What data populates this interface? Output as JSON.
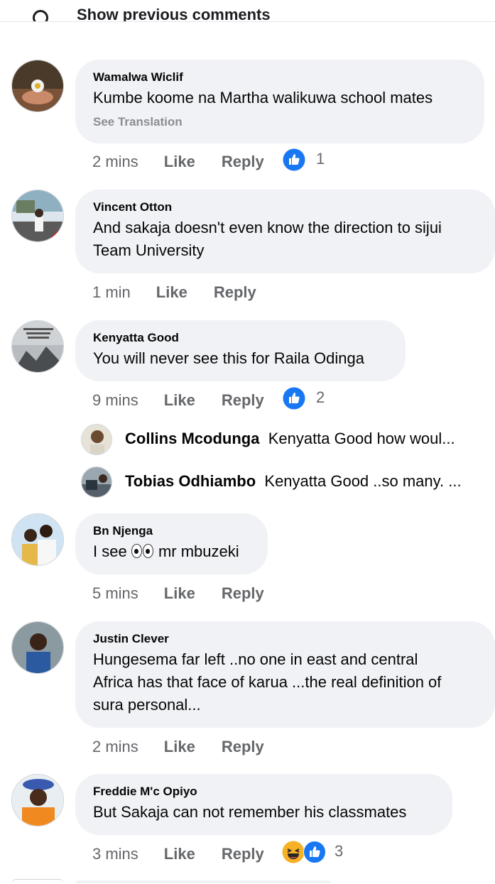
{
  "top": {
    "prev_label": "Show previous comments"
  },
  "comments": [
    {
      "author": "Wamalwa Wiclif",
      "text": "Kumbe koome na Martha walikuwa school mates",
      "see_translation": "See Translation",
      "time": "2 mins",
      "like": "Like",
      "reply": "Reply",
      "reaction_count": "1"
    },
    {
      "author": "Vincent Otton",
      "text_line1": "And sakaja doesn't even know the direction to sijui",
      "text_line2": "Team University",
      "time": "1 min",
      "like": "Like",
      "reply": "Reply"
    },
    {
      "author": "Kenyatta Good",
      "text": "You will never see this for Raila Odinga",
      "time": "9 mins",
      "like": "Like",
      "reply": "Reply",
      "reaction_count": "2",
      "replies": [
        {
          "author": "Collins Mcodunga",
          "text": "Kenyatta Good how woul..."
        },
        {
          "author": "Tobias Odhiambo",
          "text": "Kenyatta Good ..so many. ..."
        }
      ]
    },
    {
      "author": "Bn Njenga",
      "text_pre": "I see",
      "text_post": "mr mbuzeki",
      "time": "5 mins",
      "like": "Like",
      "reply": "Reply"
    },
    {
      "author": "Justin Clever",
      "text_line1": "Hungesema far left ..no one in east and central",
      "text_line2": "Africa has that face of karua ...the real definition of",
      "text_line3": "sura personal...",
      "time": "2 mins",
      "like": "Like",
      "reply": "Reply"
    },
    {
      "author": "Freddie M'c Opiyo",
      "text": "But Sakaja can not remember his classmates",
      "time": "3 mins",
      "like": "Like",
      "reply": "Reply",
      "reaction_count": "3"
    }
  ],
  "colors": {
    "bubble": "#f0f2f5",
    "like_blue": "#1877f2",
    "meta_gray": "#65676b",
    "haha_yellow": "#f7b125"
  },
  "icons": [
    "like-reaction-icon",
    "haha-reaction-icon",
    "eyes-emoji",
    "comment-icon"
  ]
}
